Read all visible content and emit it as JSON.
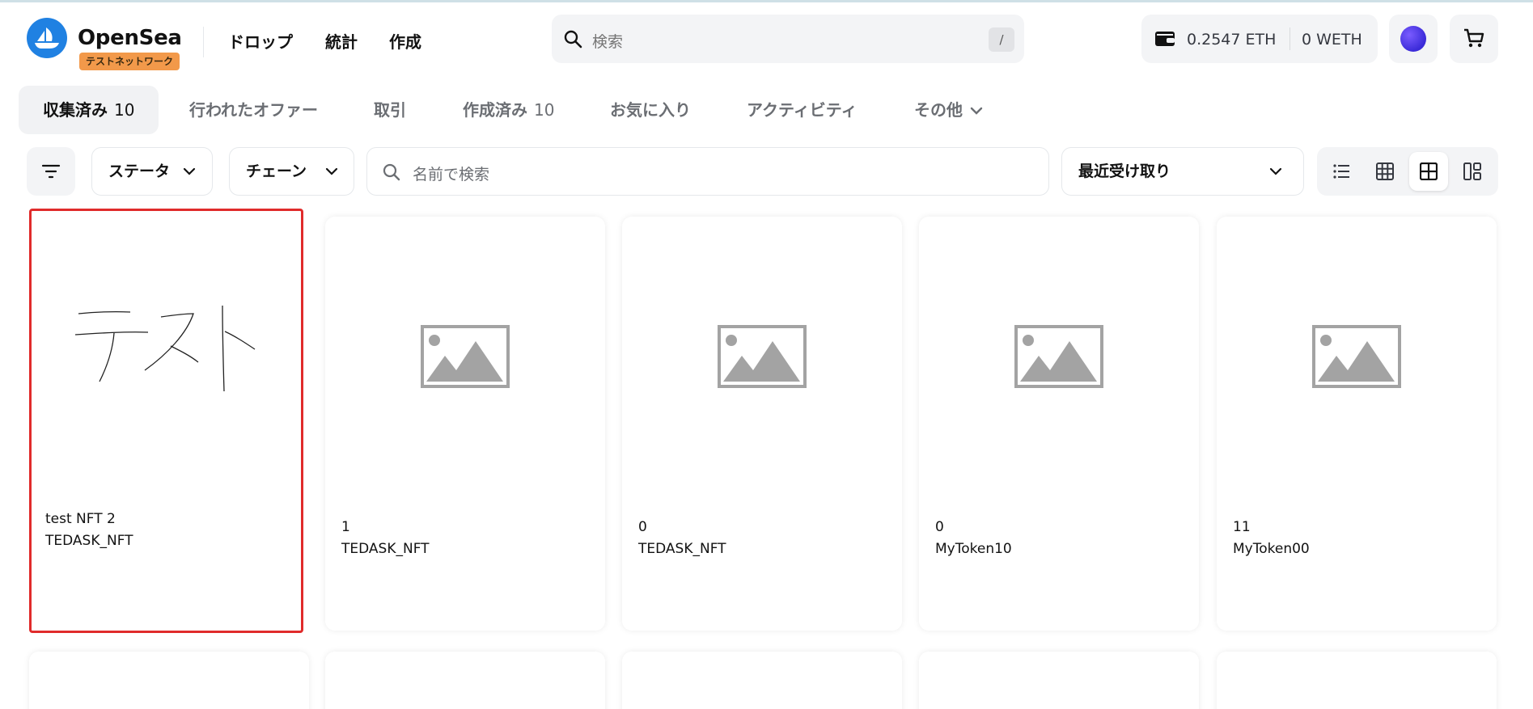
{
  "header": {
    "logo_text": "OpenSea",
    "badge": "テストネットワーク",
    "nav": [
      "ドロップ",
      "統計",
      "作成"
    ],
    "search_placeholder": "検索",
    "search_shortcut": "/",
    "wallet_eth": "0.2547 ETH",
    "wallet_weth": "0 WETH"
  },
  "tabs": [
    {
      "label": "収集済み",
      "count": "10",
      "active": true
    },
    {
      "label": "行われたオファー"
    },
    {
      "label": "取引"
    },
    {
      "label": "作成済み",
      "count": "10"
    },
    {
      "label": "お気に入り"
    },
    {
      "label": "アクティビティ"
    },
    {
      "label": "その他"
    }
  ],
  "filters": {
    "status_label": "ステータ",
    "chain_label": "チェーン",
    "name_search_placeholder": "名前で検索",
    "sort_label": "最近受け取り"
  },
  "cards": [
    {
      "name": "test NFT 2",
      "collection": "TEDASK_NFT",
      "image": "handwritten-test-drawing",
      "selected": true
    },
    {
      "name": "1",
      "collection": "TEDASK_NFT",
      "image": "image-placeholder-icon"
    },
    {
      "name": "0",
      "collection": "TEDASK_NFT",
      "image": "image-placeholder-icon"
    },
    {
      "name": "0",
      "collection": "MyToken10",
      "image": "image-placeholder-icon"
    },
    {
      "name": "11",
      "collection": "MyToken00",
      "image": "image-placeholder-icon"
    }
  ],
  "colors": {
    "brand": "#2081e2",
    "badge": "#f2994a",
    "selection": "#e02b2b"
  }
}
